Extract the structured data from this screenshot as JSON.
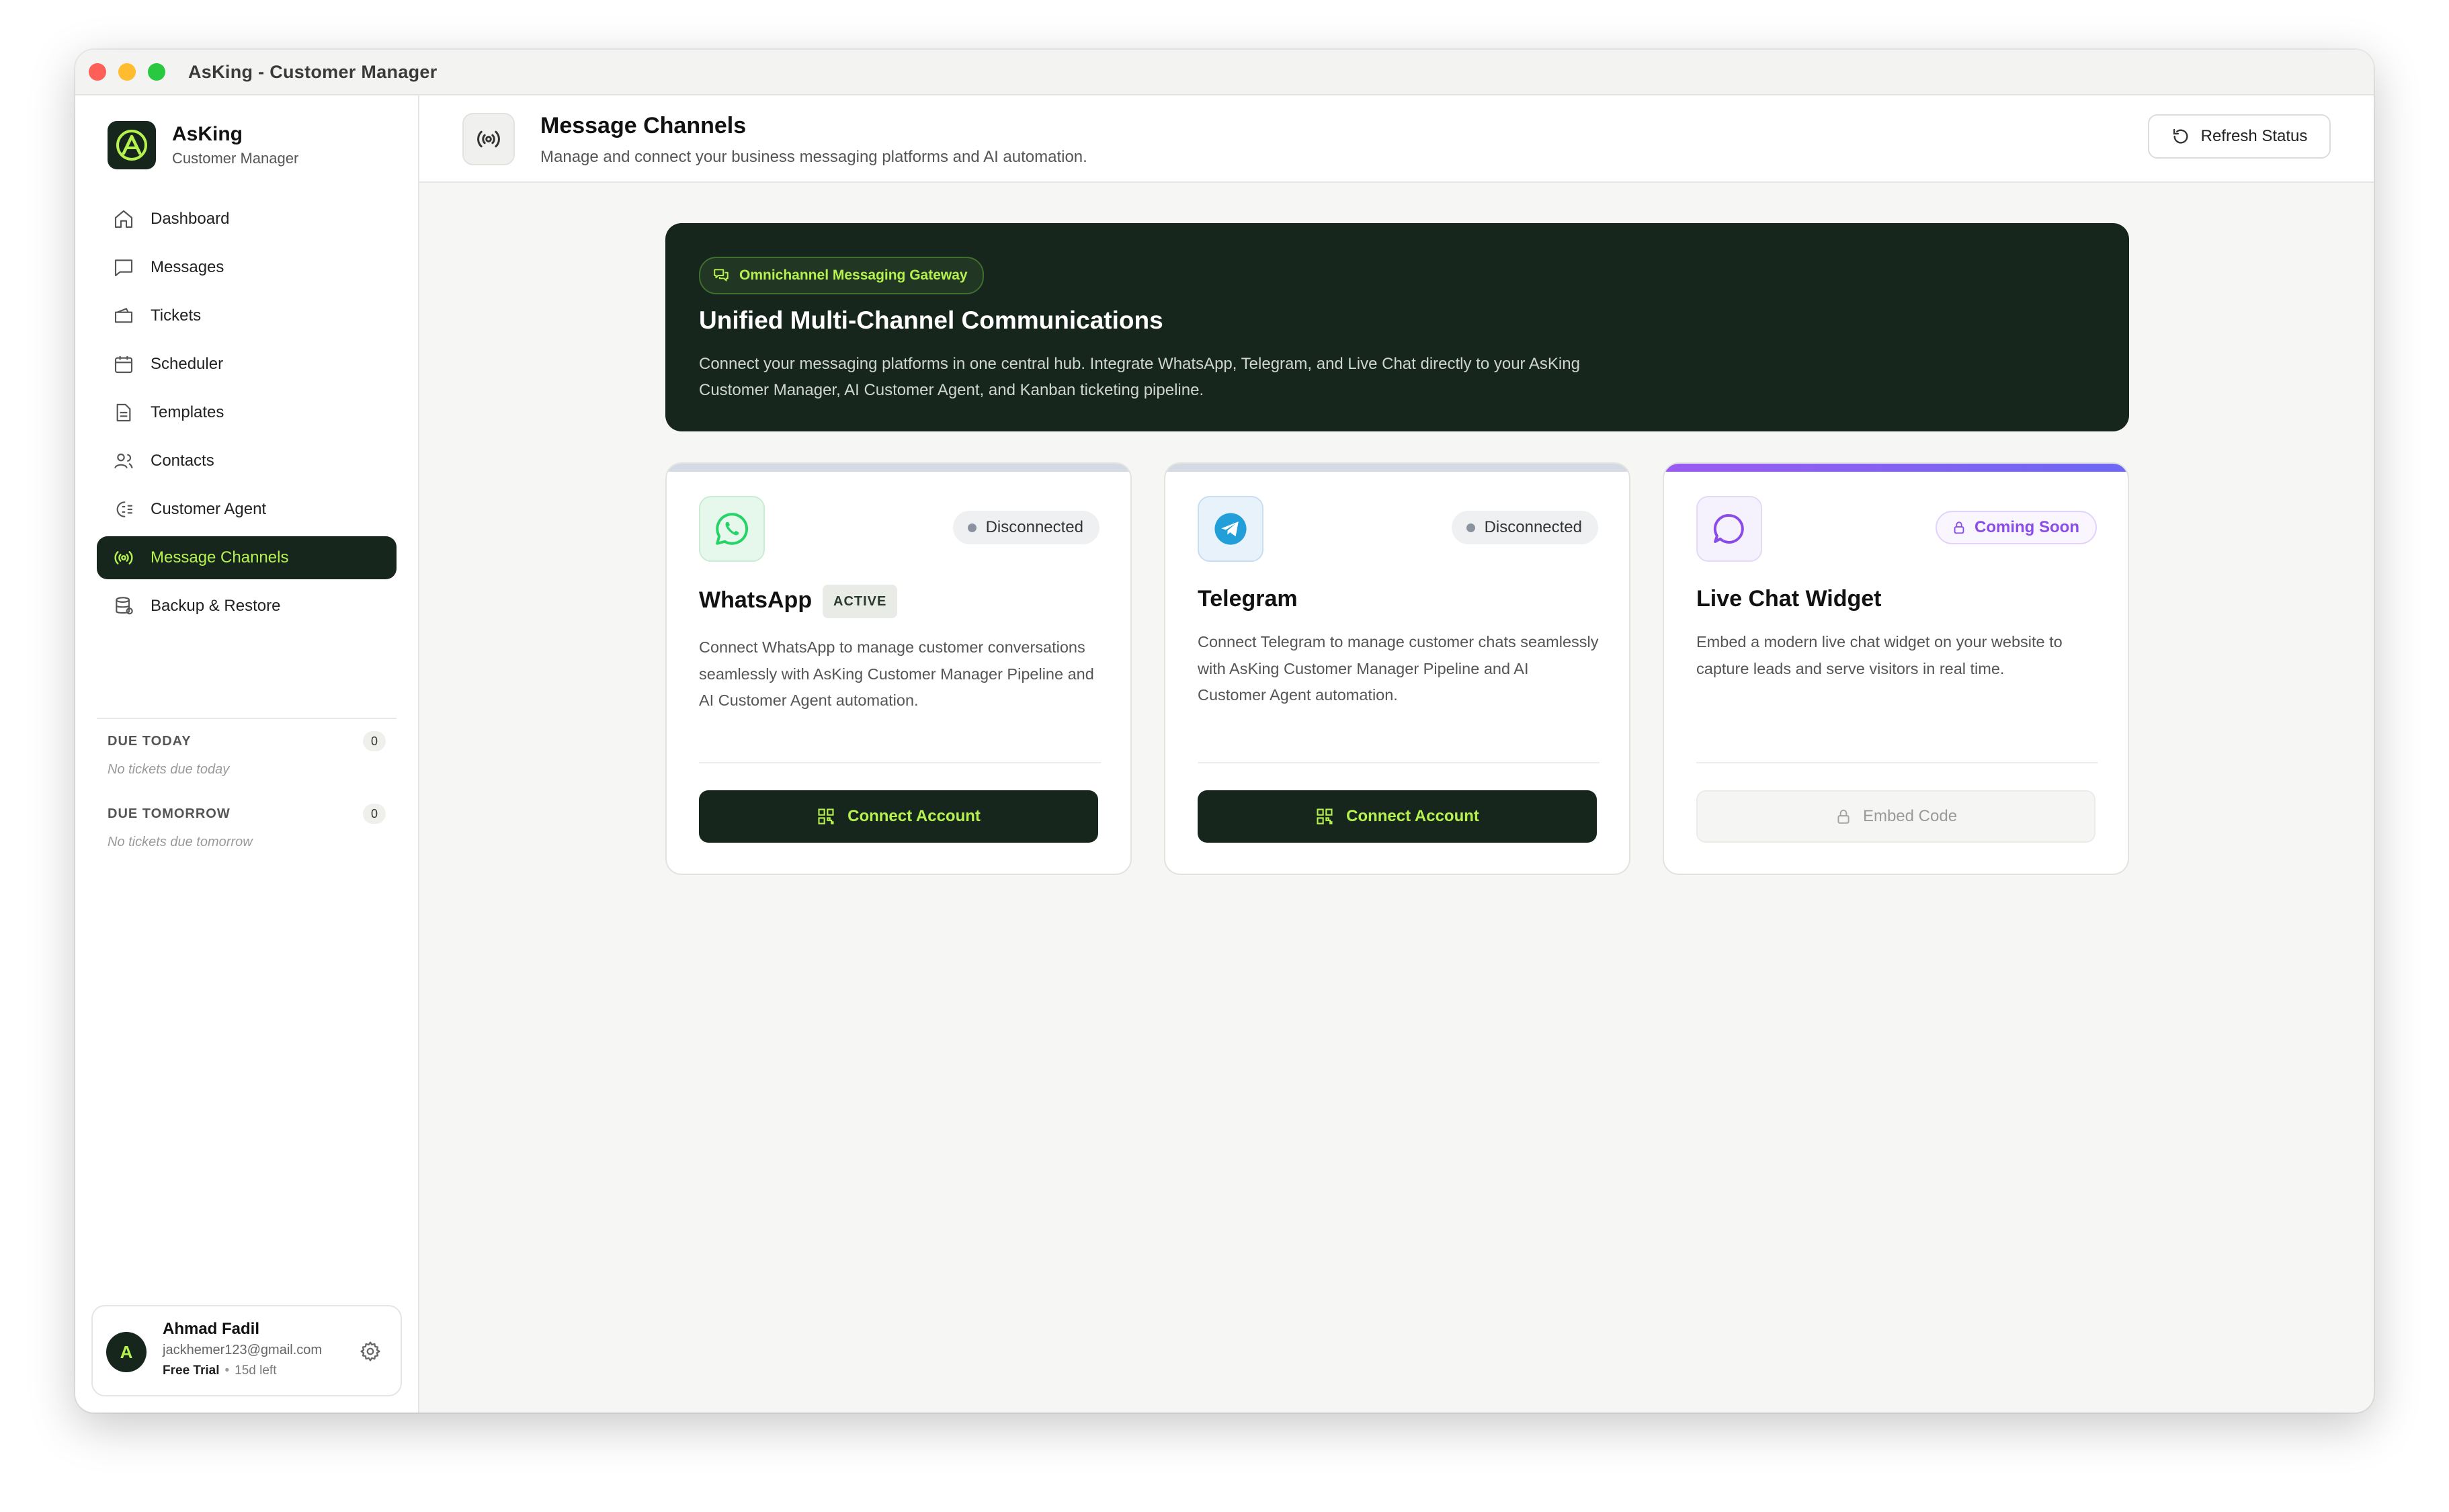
{
  "window": {
    "title": "AsKing - Customer Manager"
  },
  "brand": {
    "name": "AsKing",
    "subtitle": "Customer Manager"
  },
  "nav": {
    "items": [
      {
        "label": "Dashboard",
        "icon": "home-icon",
        "active": false
      },
      {
        "label": "Messages",
        "icon": "message-square-icon",
        "active": false
      },
      {
        "label": "Tickets",
        "icon": "ticket-icon",
        "active": false
      },
      {
        "label": "Scheduler",
        "icon": "calendar-icon",
        "active": false
      },
      {
        "label": "Templates",
        "icon": "file-text-icon",
        "active": false
      },
      {
        "label": "Contacts",
        "icon": "users-icon",
        "active": false
      },
      {
        "label": "Customer Agent",
        "icon": "ai-agent-icon",
        "active": false
      },
      {
        "label": "Message Channels",
        "icon": "broadcast-icon",
        "active": true
      },
      {
        "label": "Backup & Restore",
        "icon": "database-icon",
        "active": false
      }
    ]
  },
  "due": {
    "today": {
      "title": "DUE TODAY",
      "count": "0",
      "empty": "No tickets due today"
    },
    "tomorrow": {
      "title": "DUE TOMORROW",
      "count": "0",
      "empty": "No tickets due tomorrow"
    }
  },
  "user": {
    "initial": "A",
    "name": "Ahmad Fadil",
    "email": "jackhemer123@gmail.com",
    "plan": "Free Trial",
    "days_left": "15d left"
  },
  "header": {
    "title": "Message Channels",
    "subtitle": "Manage and connect your business messaging platforms and AI automation.",
    "refresh_label": "Refresh Status"
  },
  "hero": {
    "pill": "Omnichannel Messaging Gateway",
    "title": "Unified Multi-Channel Communications",
    "desc": "Connect your messaging platforms in one central hub. Integrate WhatsApp, Telegram, and Live Chat directly to your AsKing Customer Manager, AI Customer Agent, and Kanban ticketing pipeline."
  },
  "channels": {
    "whatsapp": {
      "name": "WhatsApp",
      "badge": "ACTIVE",
      "status": "Disconnected",
      "desc": "Connect WhatsApp to manage customer conversations seamlessly with AsKing Customer Manager Pipeline and AI Customer Agent automation.",
      "button": "Connect Account",
      "icon_color": "#25d366"
    },
    "telegram": {
      "name": "Telegram",
      "status": "Disconnected",
      "desc": "Connect Telegram to manage customer chats seamlessly with AsKing Customer Manager Pipeline and AI Customer Agent automation.",
      "button": "Connect Account",
      "icon_color": "#229ed9"
    },
    "livechat": {
      "name": "Live Chat Widget",
      "status": "Coming Soon",
      "desc": "Embed a modern live chat widget on your website to capture leads and serve visitors in real time.",
      "button": "Embed Code",
      "icon_color": "#8a4be8"
    }
  },
  "colors": {
    "brand_dark": "#17261d",
    "accent_lime": "#b6f24f",
    "status_purple": "#8a4be8"
  }
}
